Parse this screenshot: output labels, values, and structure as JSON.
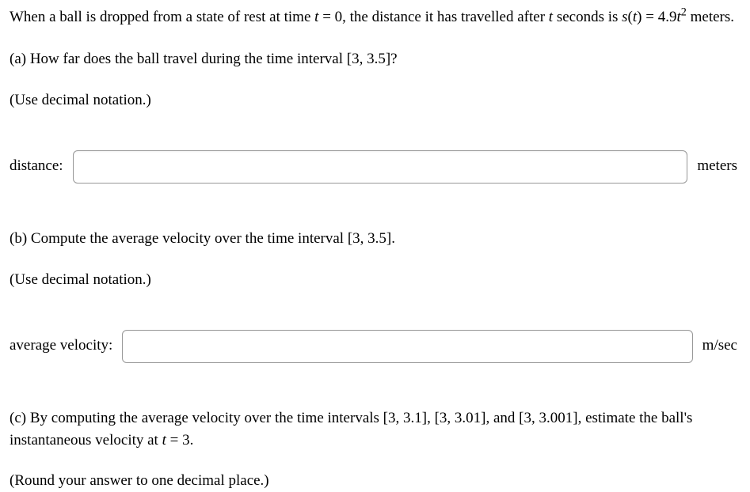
{
  "problem": {
    "intro_pre": "When a ball is dropped from a state of rest at time ",
    "intro_eq1_var": "t",
    "intro_eq1_rest": " = 0",
    "intro_mid": ", the distance it has travelled after ",
    "intro_t": "t",
    "intro_post": " seconds is ",
    "intro_eq2_pre": "s",
    "intro_eq2_paren": "(",
    "intro_eq2_var": "t",
    "intro_eq2_close": ") = 4.9",
    "intro_eq2_base": "t",
    "intro_eq2_exp": "2",
    "intro_end": " meters."
  },
  "partA": {
    "question": "(a) How far does the ball travel during the time interval [3, 3.5]?",
    "instruction": "(Use decimal notation.)",
    "label": "distance:",
    "unit": "meters"
  },
  "partB": {
    "question": "(b) Compute the average velocity over the time interval [3, 3.5].",
    "instruction": "(Use decimal notation.)",
    "label": "average velocity:",
    "unit": "m/sec"
  },
  "partC": {
    "line1_pre": "(c) By computing the average velocity over the time intervals [3, 3.1], [3, 3.01], and [3, 3.001], estimate the ball's",
    "line2_pre": "instantaneous velocity at ",
    "line2_var": "t",
    "line2_rest": " = 3.",
    "instruction": "(Round your answer to one decimal place.)"
  }
}
